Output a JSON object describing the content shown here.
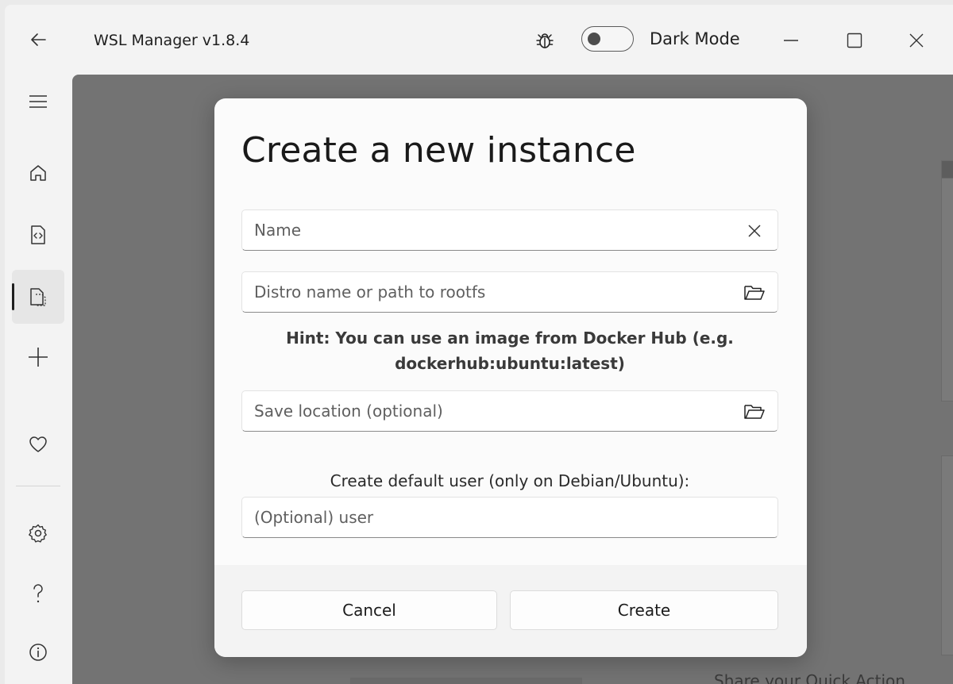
{
  "window": {
    "title": "WSL Manager v1.8.4",
    "dark_mode_label": "Dark Mode",
    "dark_mode_enabled": false
  },
  "sidebar": {
    "items": [
      {
        "name": "menu",
        "icon": "hamburger-menu-icon"
      },
      {
        "name": "home",
        "icon": "home-icon"
      },
      {
        "name": "code",
        "icon": "code-file-icon"
      },
      {
        "name": "templates",
        "icon": "copy-file-icon",
        "active": true
      },
      {
        "name": "add",
        "icon": "plus-icon"
      },
      {
        "name": "favorites",
        "icon": "heart-icon"
      },
      {
        "name": "settings",
        "icon": "gear-icon"
      },
      {
        "name": "help",
        "icon": "question-icon"
      },
      {
        "name": "info",
        "icon": "info-icon"
      }
    ]
  },
  "dialog": {
    "title": "Create a new instance",
    "name_placeholder": "Name",
    "distro_placeholder": "Distro name or path to rootfs",
    "hint_line1": "Hint: You can use an image from Docker Hub (e.g.",
    "hint_line2": "dockerhub:ubuntu:latest)",
    "save_location_placeholder": "Save location (optional)",
    "user_label": "Create default user (only on Debian/Ubuntu):",
    "user_placeholder": "(Optional) user",
    "cancel_label": "Cancel",
    "create_label": "Create"
  },
  "background": {
    "partial_text": "Share your Quick Action"
  },
  "colors": {
    "overlay": "#737373",
    "dialog_bg": "#fbfbfb",
    "footer_bg": "#f3f3f3"
  }
}
